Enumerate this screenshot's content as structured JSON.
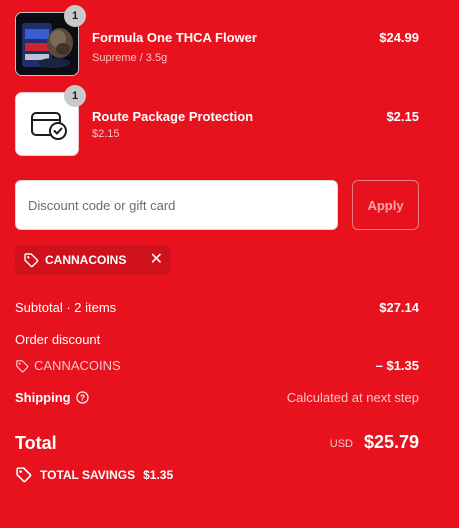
{
  "cart": {
    "items": [
      {
        "title": "Formula One THCA Flower",
        "variant": "Supreme / 3.5g",
        "price": "$24.99",
        "quantity": "1",
        "thumbnail_icon": "product-photo-icon"
      },
      {
        "title": "Route Package Protection",
        "variant": "$2.15",
        "price": "$2.15",
        "quantity": "1",
        "thumbnail_icon": "package-check-icon"
      }
    ]
  },
  "discount": {
    "placeholder": "Discount code or gift card",
    "value": "",
    "apply_label": "Apply",
    "applied_code": "CANNACOINS"
  },
  "summary": {
    "subtotal_label": "Subtotal · 2 items",
    "subtotal_value": "$27.14",
    "order_discount_label": "Order discount",
    "discount_code": "CANNACOINS",
    "discount_value": "– $1.35",
    "shipping_label": "Shipping",
    "shipping_value": "Calculated at next step",
    "total_label": "Total",
    "currency": "USD",
    "total_value": "$25.79",
    "savings_label": "TOTAL SAVINGS",
    "savings_value": "$1.35"
  },
  "colors": {
    "background": "#e8121e",
    "text": "#ffffff",
    "muted_text": "#f6c6c8",
    "chip_background": "#cf111c"
  }
}
